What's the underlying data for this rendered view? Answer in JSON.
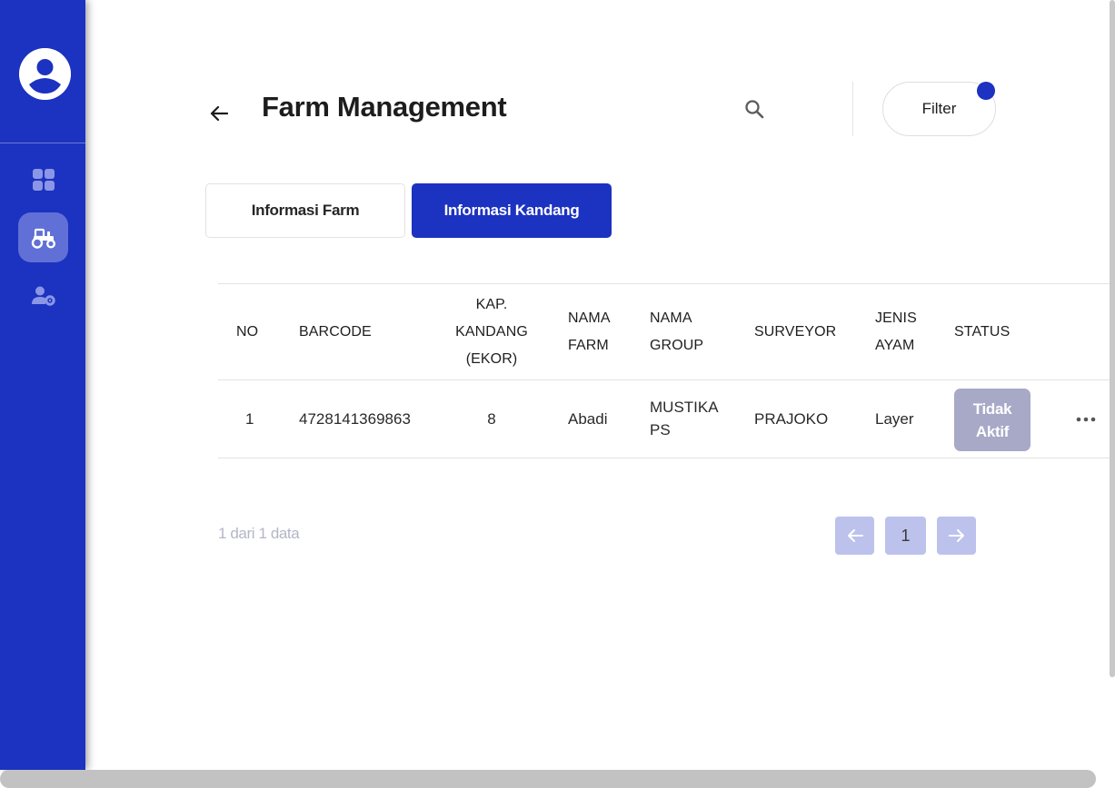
{
  "sidebar": {
    "items": [
      {
        "name": "dashboard",
        "icon": "dashboard-icon"
      },
      {
        "name": "farm",
        "icon": "tractor-icon",
        "active": true
      },
      {
        "name": "user-settings",
        "icon": "user-gear-icon"
      }
    ]
  },
  "header": {
    "title": "Farm Management",
    "filter_label": "Filter"
  },
  "tabs": [
    {
      "label": "Informasi Farm",
      "active": false
    },
    {
      "label": "Informasi Kandang",
      "active": true
    }
  ],
  "table": {
    "columns": {
      "no": "NO",
      "barcode": "BARCODE",
      "kap_line1": "KAP.",
      "kap_line2": "KANDANG",
      "kap_line3": "(EKOR)",
      "farm_line1": "NAMA",
      "farm_line2": "FARM",
      "group_line1": "NAMA",
      "group_line2": "GROUP",
      "surveyor": "SURVEYOR",
      "jenis_line1": "JENIS",
      "jenis_line2": "AYAM",
      "status": "STATUS"
    },
    "rows": [
      {
        "no": "1",
        "barcode": "4728141369863",
        "kapasitas": "8",
        "nama_farm": "Abadi",
        "group_line1": "MUSTIKA",
        "group_line2": "PS",
        "surveyor": "PRAJOKO",
        "jenis_ayam": "Layer",
        "status_line1": "Tidak",
        "status_line2": "Aktif"
      }
    ]
  },
  "pagination": {
    "summary": "1 dari 1 data",
    "current_page": "1"
  },
  "colors": {
    "primary": "#1c32c0",
    "status_inactive": "#a7a9c7",
    "pagination_bg": "#bcc2ec"
  }
}
